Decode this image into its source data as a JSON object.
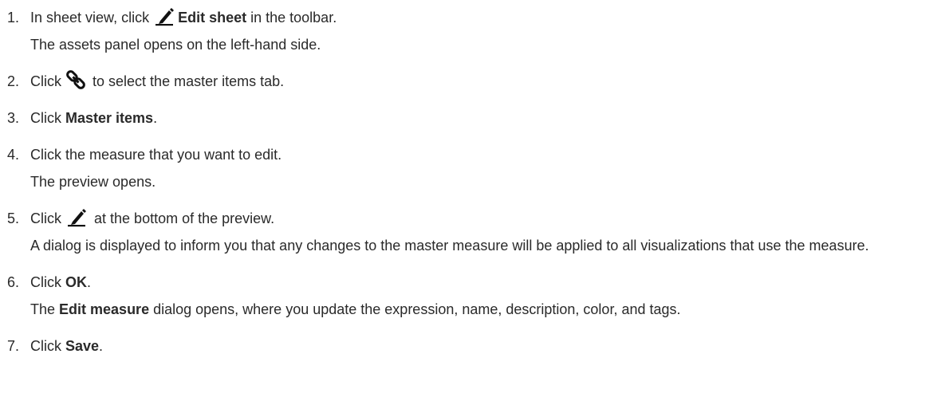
{
  "steps": [
    {
      "number": "1.",
      "pre": "In sheet view, click",
      "icon": "pencil-icon",
      "bold": "Edit sheet",
      "post": " in the toolbar.",
      "detail": "The assets panel opens on the left-hand side."
    },
    {
      "number": "2.",
      "pre": "Click",
      "icon": "link-icon",
      "post": " to select the master items tab."
    },
    {
      "number": "3.",
      "pre": "Click ",
      "bold": "Master items",
      "post": "."
    },
    {
      "number": "4.",
      "text": "Click the measure that you want to edit.",
      "detail": "The preview opens."
    },
    {
      "number": "5.",
      "pre": "Click",
      "icon": "pencil-icon",
      "post": " at the bottom of the preview.",
      "detail": "A dialog is displayed to inform you that any changes to the master measure will be applied to all visualizations that use the measure."
    },
    {
      "number": "6.",
      "pre": "Click ",
      "bold": "OK",
      "post": ".",
      "detail_pre": "The ",
      "detail_bold": "Edit measure",
      "detail_post": " dialog opens, where you update the expression, name, description, color, and tags."
    },
    {
      "number": "7.",
      "pre": "Click ",
      "bold": "Save",
      "post": "."
    }
  ],
  "colors": {
    "text": "#2a2a2a",
    "icon": "#111111",
    "background": "#ffffff"
  }
}
